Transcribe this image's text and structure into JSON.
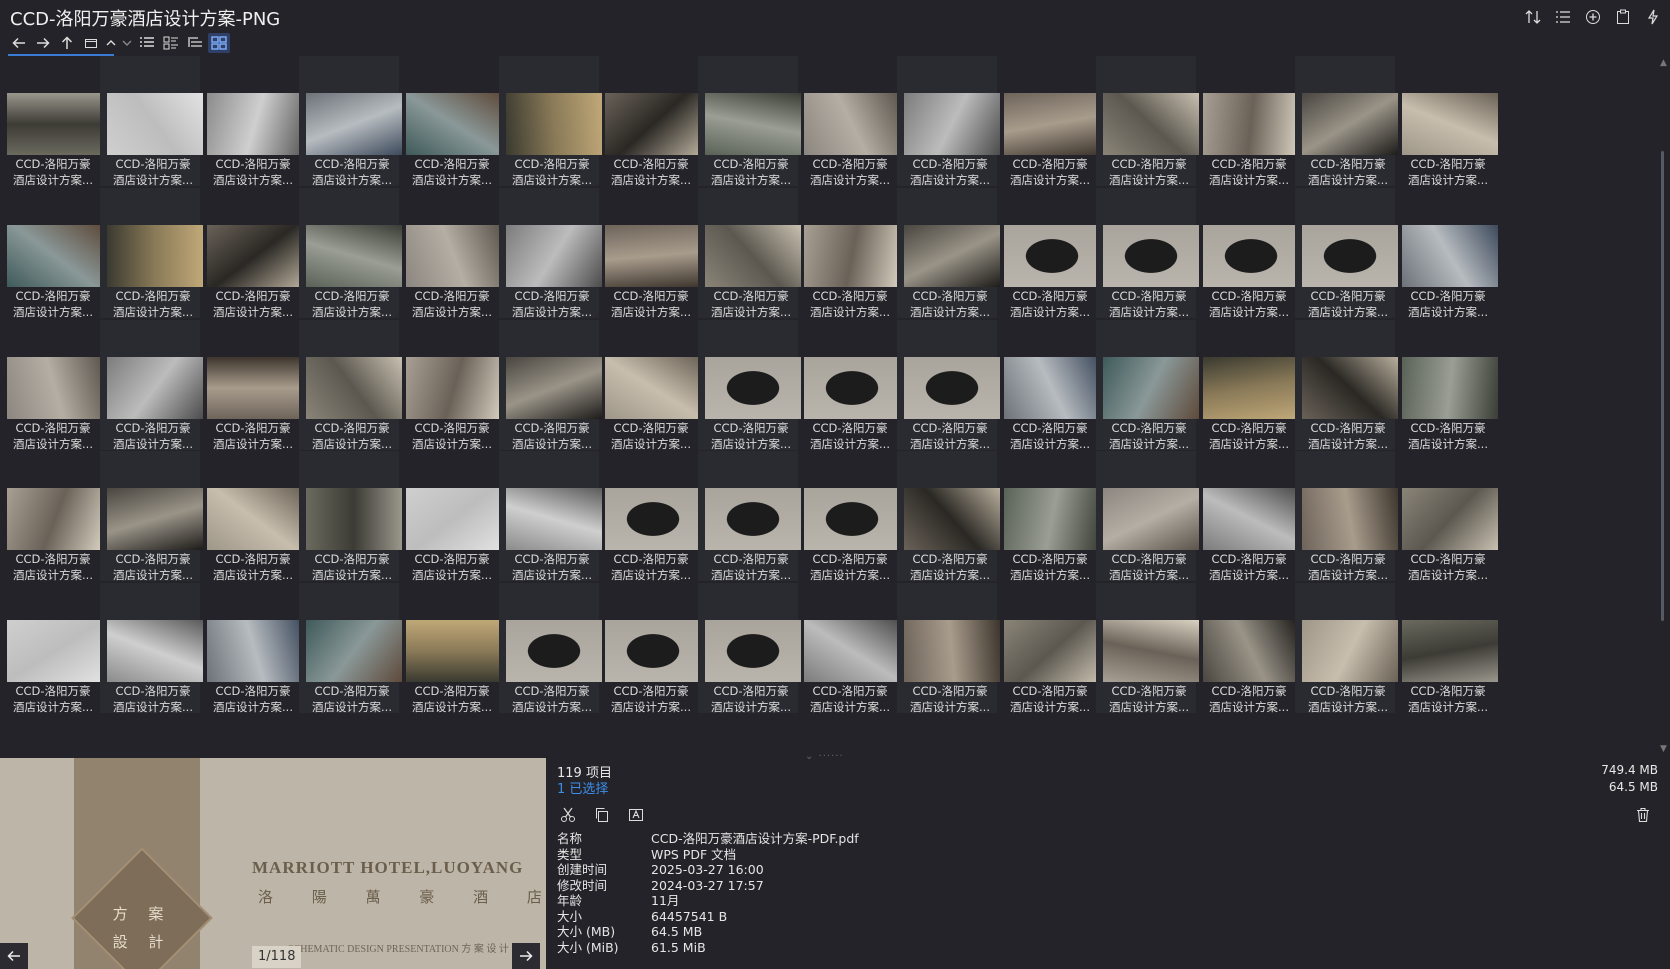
{
  "window": {
    "title": "CCD-洛阳万豪酒店设计方案-PNG"
  },
  "thumbnails": {
    "caption_line1": "CCD-洛阳万豪",
    "caption_line2": "酒店设计方案...",
    "rows": 5,
    "columns": 15,
    "palette": [
      [
        "#6b6a5e",
        "#3c3b35",
        "#9a978c"
      ],
      [
        "#cfcfcf",
        "#bdbdbd",
        "#e2e2e2"
      ],
      [
        "#8b8b8b",
        "#cfcfcf",
        "#5b5b5b"
      ],
      [
        "#6d7279",
        "#b7bcc0",
        "#3d4a5c"
      ],
      [
        "#3f5a5a",
        "#8a9898",
        "#5e4a3a"
      ],
      [
        "#3a3a30",
        "#8a7a58",
        "#c0a878"
      ],
      [
        "#6a6258",
        "#2a2824",
        "#b8ae9c"
      ],
      [
        "#5a6258",
        "#9a9e94",
        "#3a3e36"
      ],
      [
        "#8c8680",
        "#b4aea4",
        "#5a544c"
      ],
      [
        "#7c7c7c",
        "#bcbcbc",
        "#4c4c4c"
      ],
      [
        "#6e645a",
        "#a89c8c",
        "#3e362e"
      ],
      [
        "#8a8478",
        "#5c5850",
        "#c8c0b0"
      ],
      [
        "#a8a094",
        "#6a6258",
        "#d8d0c0"
      ],
      [
        "#4a4640",
        "#9a9488",
        "#1e1c1a"
      ],
      [
        "#9e9688",
        "#c8beae",
        "#6a6256"
      ]
    ],
    "dark_board_tiles": [
      25,
      26,
      27,
      28,
      37,
      38,
      39,
      51,
      52,
      53,
      65,
      66,
      67
    ]
  },
  "preview": {
    "title_en": "MARRIOTT HOTEL,LUOYANG",
    "title_cn": "洛 陽 萬 豪 酒 店",
    "subtitle": "SCHEMATIC DESIGN PRESENTATION   方 案 设 计 汇 报",
    "badge": "方 案 設 計",
    "page": "1/118"
  },
  "info": {
    "item_count": "119 项目",
    "selected": "1 已选择",
    "total_size": "749.4 MB",
    "selected_size": "64.5 MB",
    "properties": [
      {
        "key": "名称",
        "value": "CCD-洛阳万豪酒店设计方案-PDF.pdf"
      },
      {
        "key": "类型",
        "value": "WPS PDF 文档"
      },
      {
        "key": "创建时间",
        "value": "2025-03-27  16:00"
      },
      {
        "key": "修改时间",
        "value": "2024-03-27  17:57"
      },
      {
        "key": "年龄",
        "value": "11月"
      },
      {
        "key": "大小",
        "value": "64457541 B"
      },
      {
        "key": "大小 (MB)",
        "value": "64.5 MB"
      },
      {
        "key": "大小 (MiB)",
        "value": "61.5 MiB"
      }
    ]
  }
}
